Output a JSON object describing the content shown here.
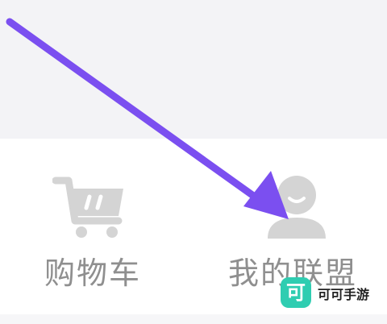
{
  "tabs": [
    {
      "label": "购物车",
      "icon": "shopping-cart-icon"
    },
    {
      "label": "我的联盟",
      "icon": "user-profile-icon"
    }
  ],
  "watermark": {
    "logo_char": "可",
    "text": "可可手游",
    "logo_color": "#2fcdb1"
  },
  "colors": {
    "arrow": "#7b4ff0",
    "icon": "#d4d4d4",
    "label": "#8f8f8f",
    "top_background": "#f3f3f6"
  }
}
